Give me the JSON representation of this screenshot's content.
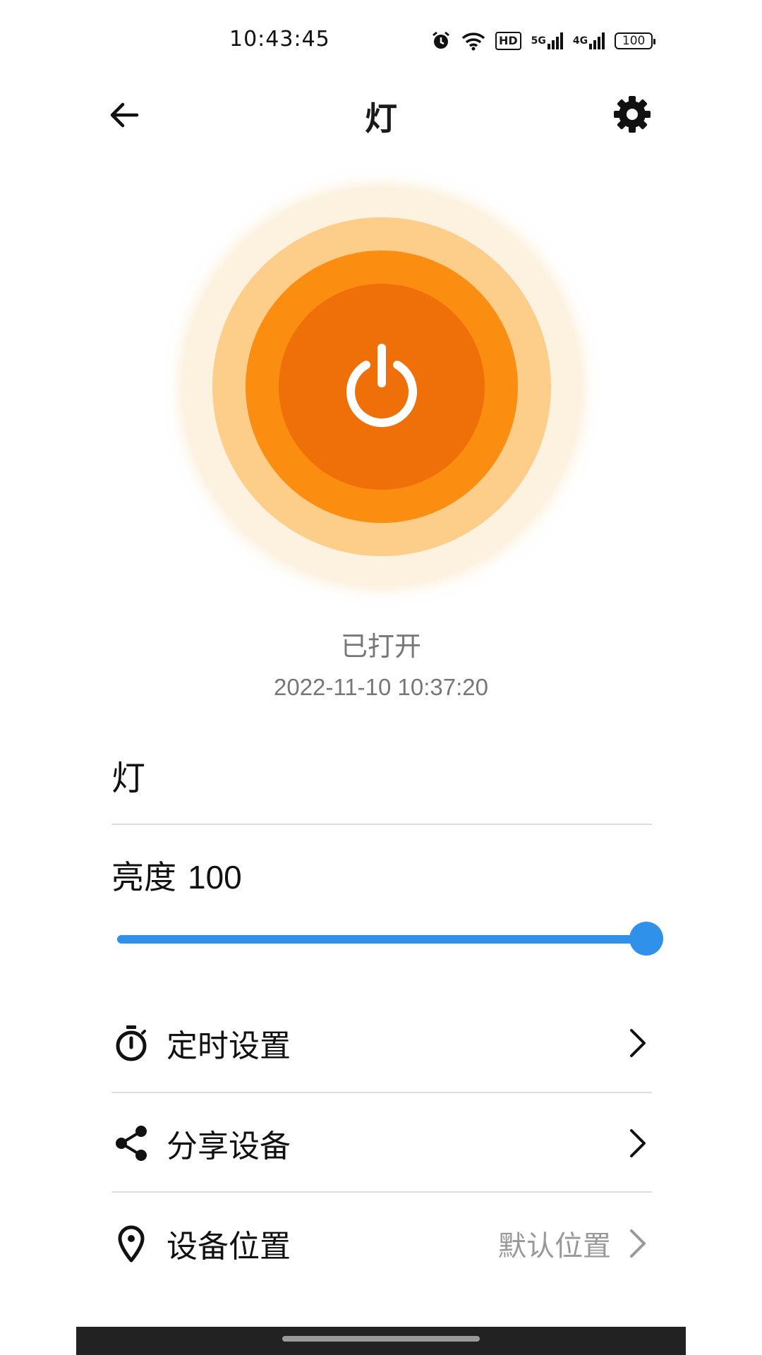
{
  "status_bar": {
    "time": "10:43:45",
    "hd_label": "HD",
    "net1_label": "5G",
    "net2_label": "4G",
    "battery": "100"
  },
  "header": {
    "title": "灯",
    "back_icon": "arrow-left",
    "settings_icon": "gear"
  },
  "power": {
    "icon": "power",
    "colors": [
      "#fdf1e0",
      "#fdcd8a",
      "#fb8d10",
      "#ef6f08"
    ],
    "state_text": "已打开",
    "state_time": "2022-11-10 10:37:20"
  },
  "device": {
    "name": "灯"
  },
  "brightness": {
    "label": "亮度",
    "value": "100",
    "percent": 100,
    "accent_color": "#2f91ea"
  },
  "menu": {
    "timer": {
      "label": "定时设置",
      "icon": "stopwatch"
    },
    "share": {
      "label": "分享设备",
      "icon": "share"
    },
    "location": {
      "label": "设备位置",
      "icon": "location-pin",
      "value": "默认位置"
    }
  }
}
